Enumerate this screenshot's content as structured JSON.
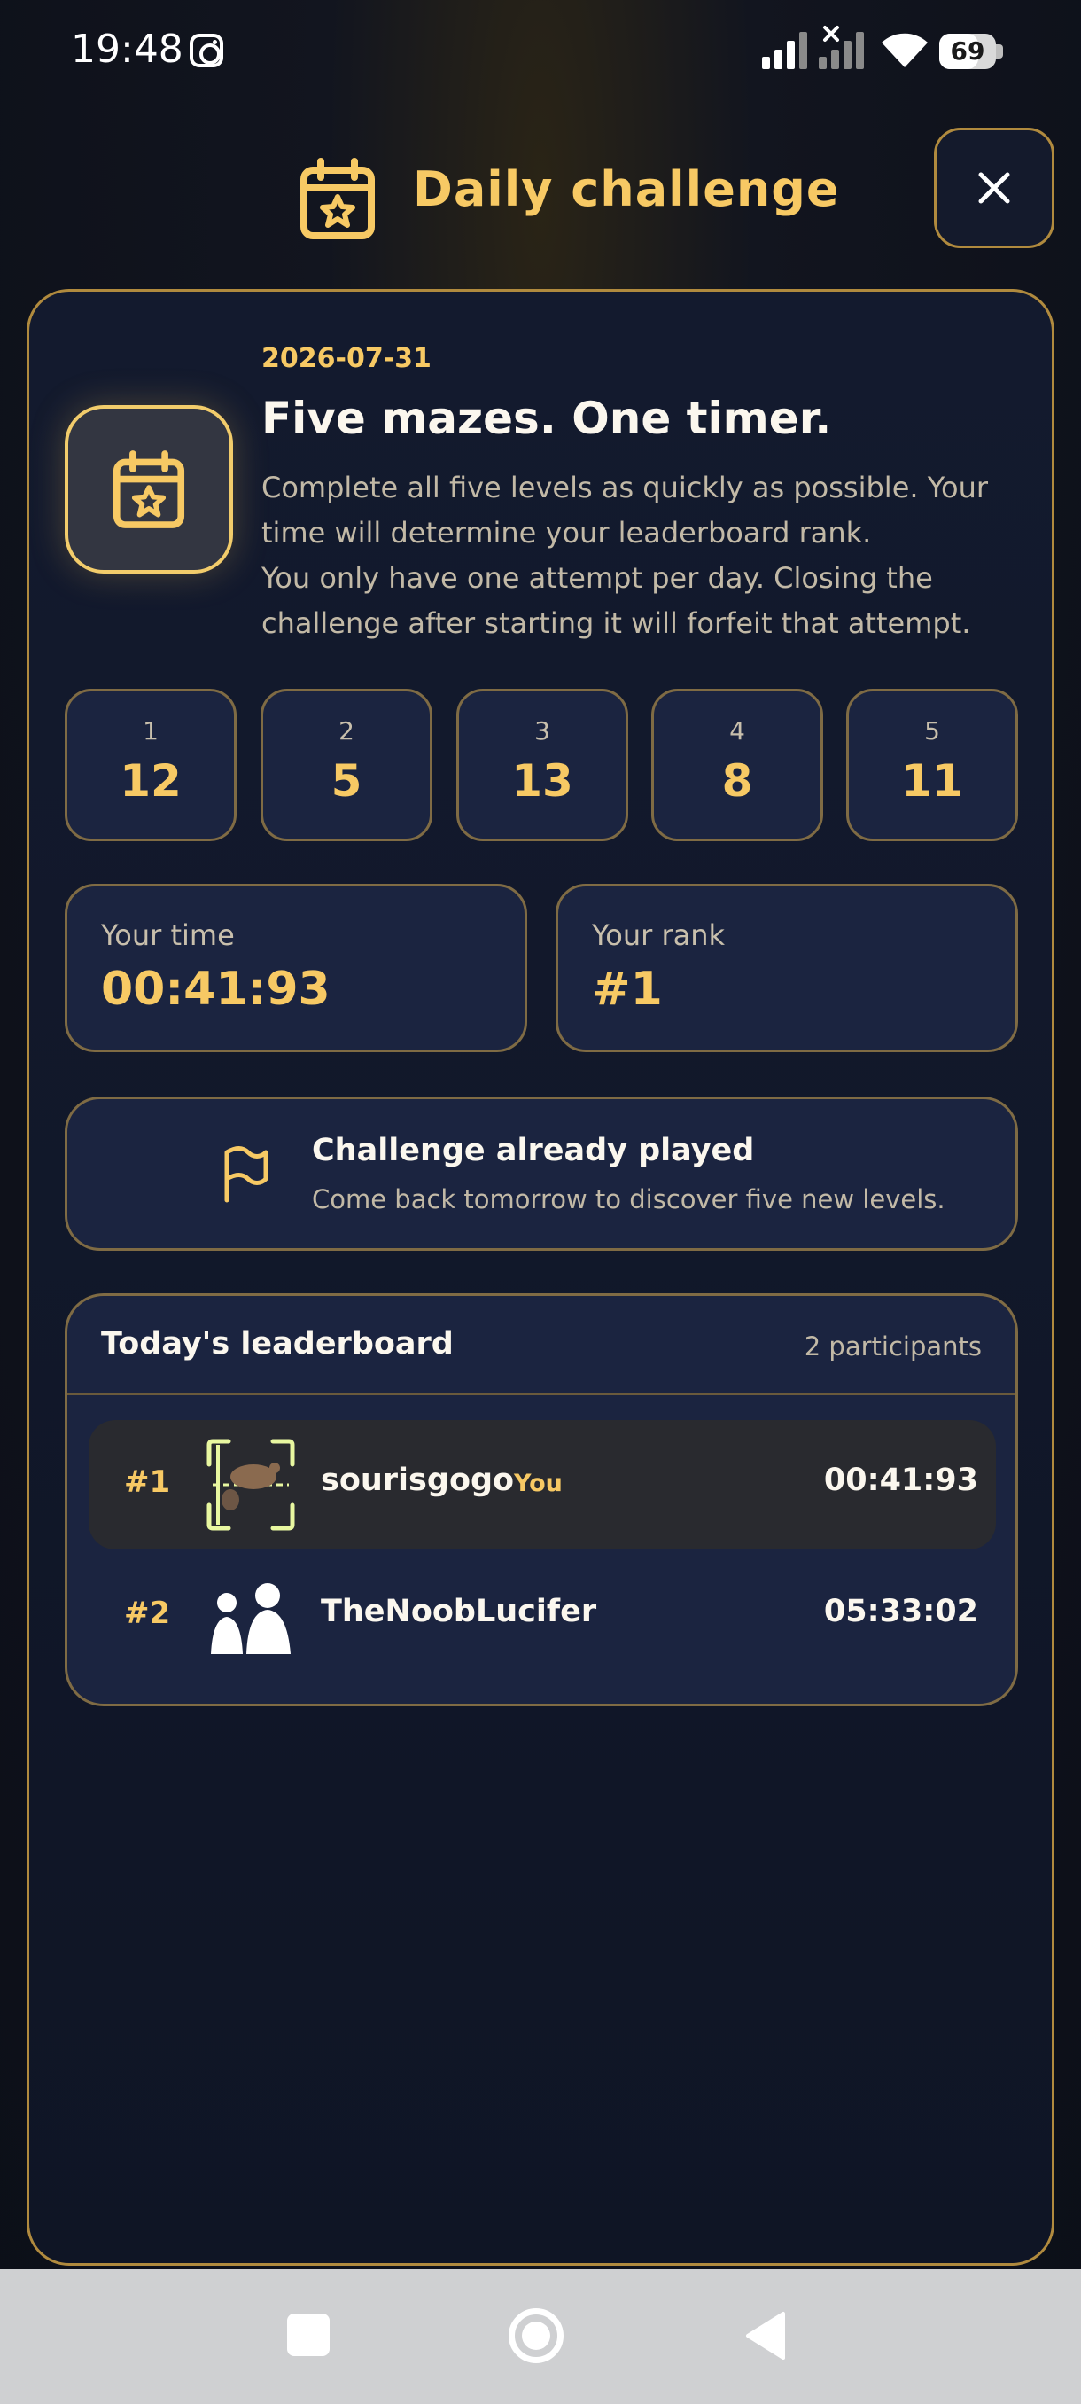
{
  "status_bar": {
    "time": "19:48",
    "battery": "69",
    "battery_level_percent": 69,
    "icons": [
      "instagram-icon",
      "signal-icon",
      "signal-off-icon",
      "wifi-icon",
      "battery-icon"
    ]
  },
  "header": {
    "title": "Daily challenge",
    "icon": "calendar-star-icon",
    "close_icon": "close-icon"
  },
  "challenge": {
    "date": "2026-07-31",
    "heading": "Five mazes. One timer.",
    "description_line1": "Complete all five levels as quickly as possible. Your time will determine your leaderboard rank.",
    "description_line2": "You only have one attempt per day. Closing the challenge after starting it will forfeit that attempt."
  },
  "levels": [
    {
      "number": "1",
      "value": "12"
    },
    {
      "number": "2",
      "value": "5"
    },
    {
      "number": "3",
      "value": "13"
    },
    {
      "number": "4",
      "value": "8"
    },
    {
      "number": "5",
      "value": "11"
    }
  ],
  "stats": {
    "time_label": "Your time",
    "time_value": "00:41:93",
    "rank_label": "Your rank",
    "rank_value": "#1"
  },
  "played": {
    "icon": "flag-icon",
    "title": "Challenge already played",
    "subtitle": "Come back tomorrow to discover five new levels."
  },
  "leaderboard": {
    "title": "Today's leaderboard",
    "count": "2 participants",
    "rows": [
      {
        "rank": "#1",
        "name": "sourisgogo",
        "badge": "You",
        "time": "00:41:93",
        "avatar": "mouse-avatar-icon"
      },
      {
        "rank": "#2",
        "name": "TheNoobLucifer",
        "badge": "",
        "time": "05:33:02",
        "avatar": "people-avatar-icon"
      }
    ]
  },
  "colors": {
    "accent": "#f7c964",
    "card_border": "#b08a3e",
    "card_bg": "#1b2440",
    "background": "#0c0f18"
  }
}
